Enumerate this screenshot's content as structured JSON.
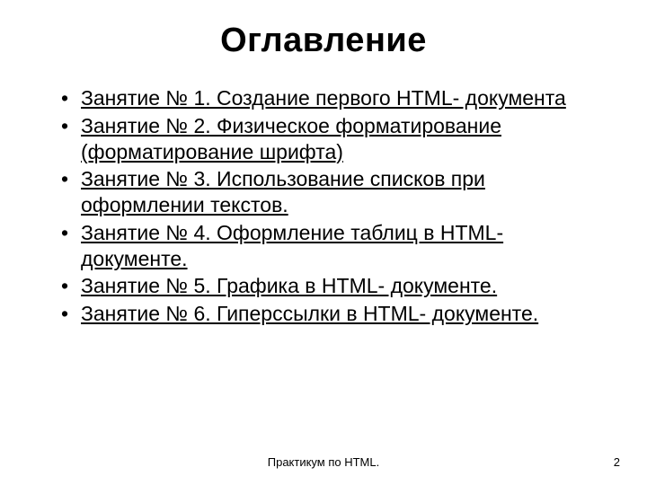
{
  "title": "Оглавление",
  "items": [
    "Занятие № 1. Создание первого HTML- документа",
    "Занятие № 2. Физическое форматирование (форматирование шрифта)",
    "Занятие № 3. Использование списков при оформлении текстов.",
    "Занятие № 4. Оформление таблиц в HTML- документе.",
    "Занятие № 5. Графика в HTML- документе.",
    "Занятие № 6. Гиперссылки в HTML- документе."
  ],
  "footer": "Практикум по HTML.",
  "page_number": "2"
}
